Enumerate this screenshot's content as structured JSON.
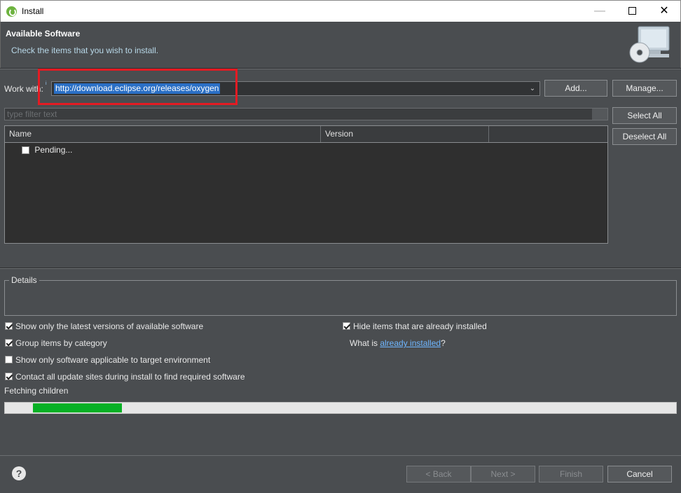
{
  "window": {
    "title": "Install",
    "controls": {
      "minimize": "—",
      "maximize": "",
      "close": "✕"
    }
  },
  "header": {
    "title": "Available Software",
    "message": "Check the items that you wish to install."
  },
  "work_with": {
    "label": "Work with:",
    "info_marker": "i",
    "value": "http://download.eclipse.org/releases/oxygen",
    "add_label": "Add...",
    "manage_label": "Manage..."
  },
  "filter": {
    "placeholder": "type filter text"
  },
  "buttons": {
    "select_all": "Select All",
    "deselect_all": "Deselect All",
    "back": "< Back",
    "next": "Next >",
    "finish": "Finish",
    "cancel": "Cancel"
  },
  "tree": {
    "columns": [
      "Name",
      "Version",
      ""
    ],
    "rows": [
      {
        "label": "Pending...",
        "checked": false
      }
    ]
  },
  "details": {
    "label": "Details"
  },
  "options": {
    "latest_versions": {
      "label": "Show only the latest versions of available software",
      "checked": true
    },
    "group_by_category": {
      "label": "Group items by category",
      "checked": true
    },
    "target_env": {
      "label": "Show only software applicable to target environment",
      "checked": false
    },
    "contact_all": {
      "label": "Contact all update sites during install to find required software",
      "checked": true
    },
    "hide_installed": {
      "label": "Hide items that are already installed",
      "checked": true
    },
    "what_is_prefix": "What is ",
    "what_is_link": "already installed",
    "what_is_suffix": "?"
  },
  "progress": {
    "label": "Fetching children",
    "segment_start": 0.042,
    "segment_end": 0.175
  },
  "help_icon": "?",
  "colors": {
    "progress_fill": "#06b025",
    "highlight": "#e41b23",
    "selection": "#2a6fc5"
  }
}
